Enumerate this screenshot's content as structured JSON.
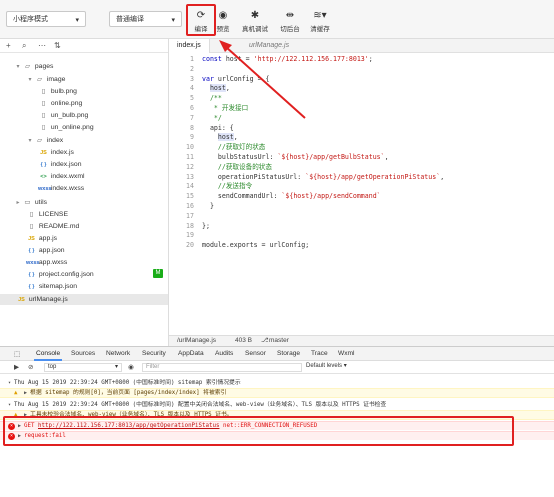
{
  "toolbar": {
    "mode_select": "小程序模式",
    "compile_select": "普通编译",
    "compile_label": "编译",
    "preview_label": "预览",
    "debug_label": "真机调试",
    "background_label": "切后台",
    "cache_label": "清缓存"
  },
  "sidebar": {
    "items": [
      {
        "label": "pages",
        "type": "folder-open"
      },
      {
        "label": "image",
        "type": "folder-open"
      },
      {
        "label": "bulb.png",
        "type": "file"
      },
      {
        "label": "online.png",
        "type": "file"
      },
      {
        "label": "un_bulb.png",
        "type": "file"
      },
      {
        "label": "un_online.png",
        "type": "file"
      },
      {
        "label": "index",
        "type": "folder-open"
      },
      {
        "label": "index.js",
        "type": "js",
        "badge": "JS"
      },
      {
        "label": "index.json",
        "type": "json",
        "badge": "{ }"
      },
      {
        "label": "index.wxml",
        "type": "wxml",
        "badge": "<>"
      },
      {
        "label": "index.wxss",
        "type": "wxss",
        "badge": "wxss"
      },
      {
        "label": "utils",
        "type": "folder"
      },
      {
        "label": "LICENSE",
        "type": "file"
      },
      {
        "label": "README.md",
        "type": "file"
      },
      {
        "label": "app.js",
        "type": "js",
        "badge": "JS"
      },
      {
        "label": "app.json",
        "type": "json",
        "badge": "{ }"
      },
      {
        "label": "app.wxss",
        "type": "wxss",
        "badge": "wxss"
      },
      {
        "label": "project.config.json",
        "type": "json",
        "badge": "{ }"
      },
      {
        "label": "sitemap.json",
        "type": "json",
        "badge": "{ }"
      },
      {
        "label": "urlManage.js",
        "type": "js",
        "badge": "JS"
      }
    ],
    "m_badge": "M"
  },
  "editor": {
    "tabs": [
      {
        "label": "index.js",
        "active": true
      },
      {
        "label": "urlManage.js",
        "active": false
      }
    ],
    "lines": [
      {
        "n": "1",
        "text": "const host = 'http://122.112.156.177:8013';"
      },
      {
        "n": "2",
        "text": ""
      },
      {
        "n": "3",
        "text": "var urlConfig = {"
      },
      {
        "n": "4",
        "text": "  host,"
      },
      {
        "n": "5",
        "text": "  /**"
      },
      {
        "n": "6",
        "text": "   * 开发接口"
      },
      {
        "n": "7",
        "text": "   */"
      },
      {
        "n": "8",
        "text": "  api: {"
      },
      {
        "n": "9",
        "text": "    host,"
      },
      {
        "n": "10",
        "text": "    //获取灯的状态"
      },
      {
        "n": "11",
        "text": "    bulbStatusUrl: `${host}/app/getBulbStatus`,"
      },
      {
        "n": "12",
        "text": "    //获取设备的状态"
      },
      {
        "n": "13",
        "text": "    operationPiStatusUrl: `${host}/app/getOperationPiStatus`,"
      },
      {
        "n": "14",
        "text": "    //发送指令"
      },
      {
        "n": "15",
        "text": "    sendCommandUrl: `${host}/app/sendCommand`"
      },
      {
        "n": "16",
        "text": "  }"
      },
      {
        "n": "17",
        "text": ""
      },
      {
        "n": "18",
        "text": "};"
      },
      {
        "n": "19",
        "text": ""
      },
      {
        "n": "20",
        "text": "module.exports = urlConfig;"
      }
    ],
    "status_file": "/urlManage.js",
    "status_size": "403 B",
    "status_branch": "master"
  },
  "devtools": {
    "tabs": [
      "Console",
      "Sources",
      "Network",
      "Security",
      "AppData",
      "Audits",
      "Sensor",
      "Storage",
      "Trace",
      "Wxml"
    ],
    "context": "top",
    "filter_placeholder": "Filter",
    "levels": "Default levels",
    "logs": [
      {
        "type": "info",
        "text": "Thu Aug 15 2019 22:39:24 GMT+0800 (中国标准时间) sitemap 索引情况提示"
      },
      {
        "type": "warn",
        "text": "根据 sitemap 的规则[0]，当前页面 [pages/index/index] 将被索引"
      },
      {
        "type": "info",
        "text": "Thu Aug 15 2019 22:39:24 GMT+0800 (中国标准时间) 配置中关闭合法域名、web-view（业务域名）、TLS 版本以及 HTTPS 证书检查"
      },
      {
        "type": "warn",
        "text": "工具未校验合法域名、web-view（业务域名）、TLS 版本以及 HTTPS 证书。"
      },
      {
        "type": "error",
        "prefix": "GET",
        "url": "http://122.112.156.177:8013/app/getOperationPiStatus",
        "suffix": "net::ERR_CONNECTION_REFUSED"
      },
      {
        "type": "error",
        "text": "request:fail"
      }
    ]
  }
}
